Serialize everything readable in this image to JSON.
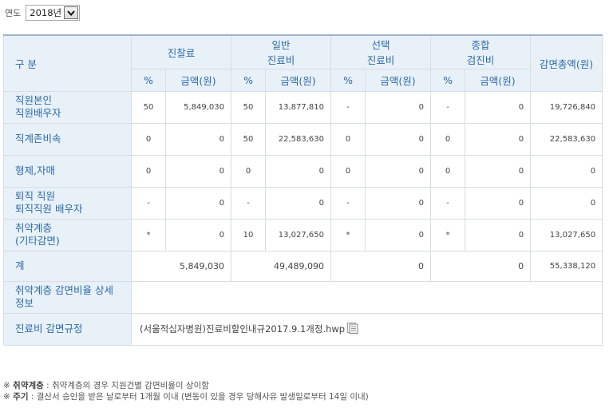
{
  "filter": {
    "year_label": "연도",
    "year_value": "2018년"
  },
  "table": {
    "corner_label": "구 분",
    "groups": [
      {
        "label": [
          "진찰료"
        ]
      },
      {
        "label": [
          "일반",
          "진료비"
        ]
      },
      {
        "label": [
          "선택",
          "진료비"
        ]
      },
      {
        "label": [
          "종합",
          "검진비"
        ]
      }
    ],
    "sub_percent": "%",
    "sub_amount": "금액(원)",
    "total_header": "감면총액(원)",
    "rows": [
      {
        "label": [
          "직원본인",
          "직원배우자"
        ],
        "cells": [
          "50",
          "5,849,030",
          "50",
          "13,877,810",
          "-",
          "0",
          "-",
          "0"
        ],
        "total": "19,726,840"
      },
      {
        "label": [
          "직계존비속"
        ],
        "cells": [
          "0",
          "0",
          "50",
          "22,583,630",
          "0",
          "0",
          "0",
          "0"
        ],
        "total": "22,583,630"
      },
      {
        "label": [
          "형제,자매"
        ],
        "cells": [
          "0",
          "0",
          "0",
          "0",
          "0",
          "0",
          "0",
          "0"
        ],
        "total": "0"
      },
      {
        "label": [
          "퇴직 직원",
          "퇴직직원 배우자"
        ],
        "cells": [
          "-",
          "0",
          "-",
          "0",
          "-",
          "0",
          "-",
          "0"
        ],
        "total": "0"
      },
      {
        "label": [
          "취약계층",
          "(기타감면)"
        ],
        "cells": [
          "*",
          "0",
          "10",
          "13,027,650",
          "*",
          "0",
          "*",
          "0"
        ],
        "total": "13,027,650"
      }
    ],
    "sum_row": {
      "label": "계",
      "values": [
        "5,849,030",
        "49,489,090",
        "0",
        "0"
      ],
      "total": "55,338,120"
    },
    "detail_row": {
      "label": [
        "취약계층 감면비율 상세",
        "정보"
      ]
    },
    "regulation_row": {
      "label": "진료비 감면규정",
      "file": "(서울적십자병원)진료비할인내규2017.9.1개정.hwp"
    }
  },
  "notes": [
    {
      "mark": "※",
      "title": "취약계층",
      "text": " : 취약계층의 경우 지원건별 감면비율이 상이함"
    },
    {
      "mark": "※",
      "title": "주기",
      "text": " : 결산서 승인을 받은 날로부터 1개월 이내 (변동이 있을 경우 당해사유 발생일로부터 14일 이내)"
    }
  ],
  "icons": {
    "dropdown": "chevron-down-icon",
    "file": "document-icon"
  }
}
